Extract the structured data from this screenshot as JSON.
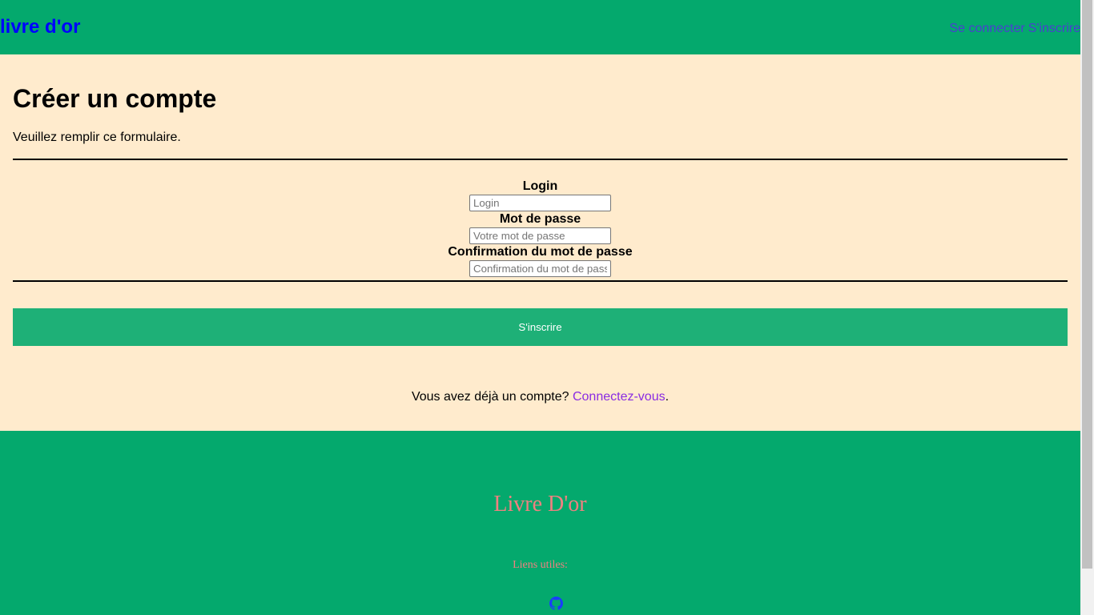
{
  "header": {
    "site_title": "livre d'or",
    "nav": {
      "login": "Se connecter",
      "register": "S'inscrire"
    }
  },
  "main": {
    "title": "Créer un compte",
    "intro": "Veuillez remplir ce formulaire.",
    "fields": {
      "login": {
        "label": "Login",
        "placeholder": "Login",
        "value": ""
      },
      "password": {
        "label": "Mot de passe",
        "placeholder": "Votre mot de passe",
        "value": ""
      },
      "confirm": {
        "label": "Confirmation du mot de passe",
        "placeholder": "Confirmation du mot de passe",
        "value": ""
      }
    },
    "submit_label": "S'inscrire",
    "login_prompt": "Vous avez déjà un compte? ",
    "login_link": "Connectez-vous",
    "login_suffix": "."
  },
  "footer": {
    "title": "Livre D'or",
    "links_label": "Liens utiles:",
    "github_icon": "github-icon"
  },
  "colors": {
    "header_bg": "#04a96d",
    "page_bg": "#ffebcd",
    "submit_bg": "#1eb077",
    "site_title": "#0000ff",
    "footer_text": "#f08080",
    "link": "#8a2be2"
  }
}
